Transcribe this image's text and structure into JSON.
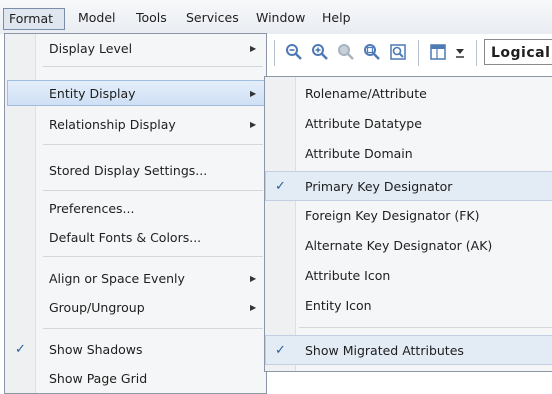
{
  "menubar": {
    "items": [
      "Format",
      "Model",
      "Tools",
      "Services",
      "Window",
      "Help"
    ]
  },
  "toolbar": {
    "icons": [
      "zoom-out-icon",
      "zoom-in-icon",
      "zoom-disabled-icon",
      "zoom-fit-icon",
      "zoom-window-icon",
      "layout-icon"
    ],
    "dropdown_icon": "dropdown-arrow-icon",
    "view_value": "Logical"
  },
  "format_menu": {
    "items": [
      {
        "label": "Display Level",
        "submenu": true
      },
      {
        "label": "Entity Display",
        "submenu": true,
        "highlighted": true
      },
      {
        "label": "Relationship Display",
        "submenu": true
      },
      {
        "label": "Stored Display Settings..."
      },
      {
        "label": "Preferences..."
      },
      {
        "label": "Default Fonts & Colors..."
      },
      {
        "label": "Align or Space Evenly",
        "submenu": true
      },
      {
        "label": "Group/Ungroup",
        "submenu": true
      },
      {
        "label": "Show Shadows",
        "checked": true
      },
      {
        "label": "Show Page Grid"
      }
    ]
  },
  "entity_display_menu": {
    "items": [
      {
        "label": "Rolename/Attribute"
      },
      {
        "label": "Attribute Datatype"
      },
      {
        "label": "Attribute Domain"
      },
      {
        "label": "Primary Key Designator",
        "checked": true
      },
      {
        "label": "Foreign Key Designator (FK)"
      },
      {
        "label": "Alternate Key Designator (AK)"
      },
      {
        "label": "Attribute Icon"
      },
      {
        "label": "Entity Icon"
      },
      {
        "label": "Show Migrated Attributes",
        "checked": true
      }
    ]
  },
  "glyphs": {
    "check": "✓",
    "arrow": "▶"
  },
  "colors": {
    "highlight": "#cfe0f5",
    "check": "#2a5fa0",
    "icon": "#4d79b4"
  }
}
